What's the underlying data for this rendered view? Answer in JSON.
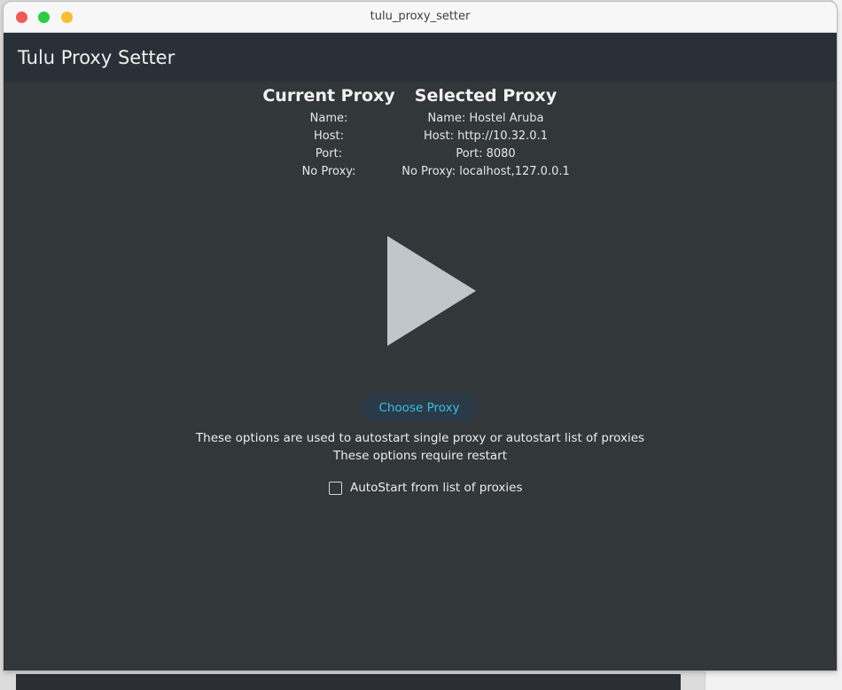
{
  "window": {
    "title": "tulu_proxy_setter"
  },
  "app": {
    "title": "Tulu Proxy Setter"
  },
  "current_proxy": {
    "heading": "Current Proxy",
    "name_label": "Name:",
    "host_label": "Host:",
    "port_label": "Port:",
    "no_proxy_label": "No Proxy:"
  },
  "selected_proxy": {
    "heading": "Selected Proxy",
    "name": "Name: Hostel Aruba",
    "host": "Host: http://10.32.0.1",
    "port": "Port: 8080",
    "no_proxy": "No Proxy: localhost,127.0.0.1"
  },
  "controls": {
    "play_icon": "play-icon",
    "choose_proxy_label": "Choose Proxy",
    "info_line1": "These options are used to autostart single proxy or autostart list of proxies",
    "info_line2": "These options require restart",
    "autostart_label": "AutoStart from list of proxies",
    "autostart_checked": false
  },
  "colors": {
    "background": "#32373a",
    "appbar": "#2a3038",
    "accent": "#3bbfe3",
    "play_icon": "#c0c7ca"
  }
}
